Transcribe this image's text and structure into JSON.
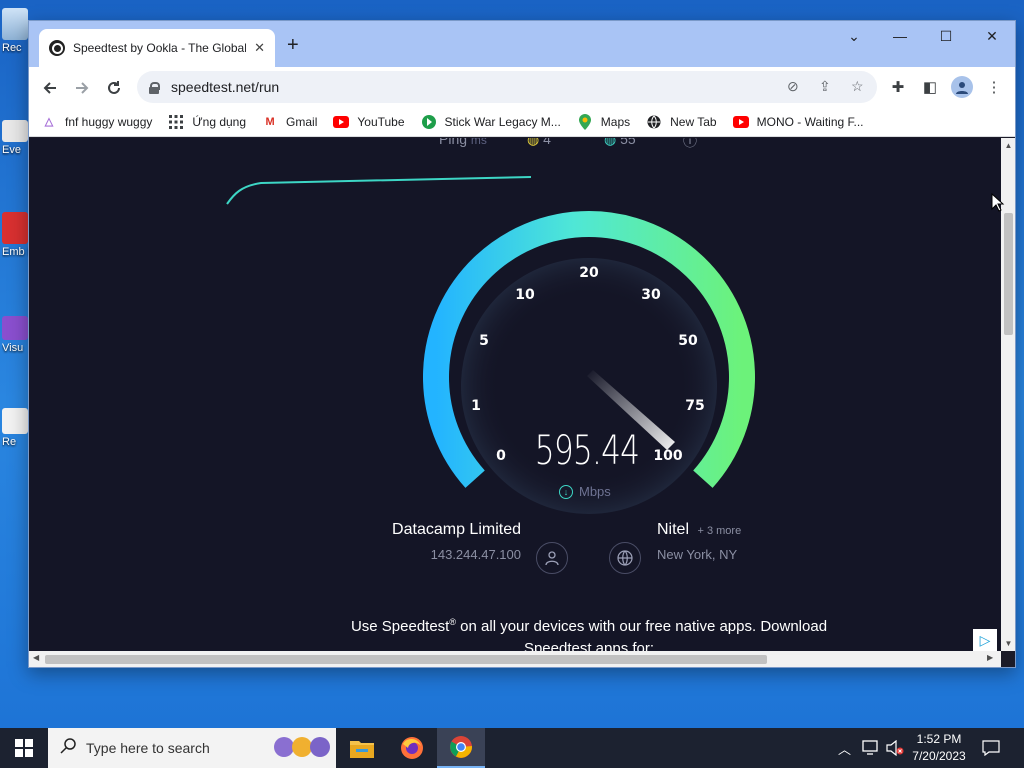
{
  "colors": {
    "accent": "#1aa0d8",
    "gauge_start": "#23b4ff",
    "gauge_end": "#6cf27a",
    "page_bg": "#141526"
  },
  "desktop": {
    "icons": [
      "Rec",
      "Eve",
      "Emb De",
      "Visu",
      "Re"
    ]
  },
  "browser": {
    "tab_title": "Speedtest by Ookla - The Global",
    "tab_close": "✕",
    "new_tab": "+",
    "window_controls": {
      "dropdown": "⌄",
      "minimize": "—",
      "maximize": "☐",
      "close": "✕"
    },
    "url": "speedtest.net/run",
    "bookmarks": [
      {
        "label": "fnf huggy wuggy",
        "icon": "triangle-icon"
      },
      {
        "label": "Ứng dụng",
        "icon": "apps-grid-icon"
      },
      {
        "label": "Gmail",
        "icon": "gmail-icon"
      },
      {
        "label": "YouTube",
        "icon": "youtube-icon"
      },
      {
        "label": "Stick War Legacy M...",
        "icon": "game-icon"
      },
      {
        "label": "Maps",
        "icon": "maps-pin-icon"
      },
      {
        "label": "New Tab",
        "icon": "globe-icon"
      },
      {
        "label": "MONO - Waiting F...",
        "icon": "youtube-icon"
      }
    ]
  },
  "speedtest": {
    "legend_ping": "Ping",
    "legend_ping_unit": "ms",
    "legend_download": "4",
    "legend_upload": "55",
    "gauge_ticks": [
      "0",
      "1",
      "5",
      "10",
      "20",
      "30",
      "50",
      "75",
      "100"
    ],
    "speed_value": "595.44",
    "speed_unit": "Mbps",
    "isp_name": "Datacamp Limited",
    "isp_ip": "143.244.47.100",
    "server_name": "Nitel",
    "server_more": "+ 3 more",
    "server_location": "New York, NY",
    "promo_text_1": "Use Speedtest",
    "promo_reg": "®",
    "promo_text_2": " on all your devices with our free native apps. Download Speedtest apps for:"
  },
  "taskbar": {
    "search_placeholder": "Type here to search",
    "time": "1:52 PM",
    "date": "7/20/2023"
  }
}
